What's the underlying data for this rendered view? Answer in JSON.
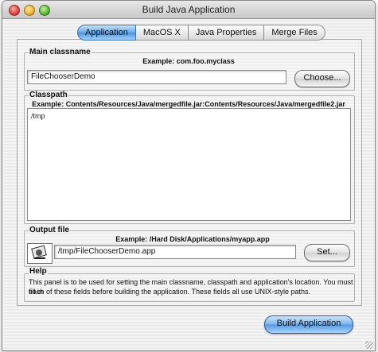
{
  "window": {
    "title": "Build Java Application"
  },
  "tabs": [
    {
      "label": "Application",
      "active": true
    },
    {
      "label": "MacOS X",
      "active": false
    },
    {
      "label": "Java Properties",
      "active": false
    },
    {
      "label": "Merge Files",
      "active": false
    }
  ],
  "main_classname": {
    "label": "Main classname",
    "example": "Example: com.foo.myclass",
    "value": "FileChooserDemo",
    "choose_button": "Choose..."
  },
  "classpath": {
    "label": "Classpath",
    "example": "Example: Contents/Resources/Java/mergedfile.jar:Contents/Resources/Java/mergedfile2.jar",
    "value": "/tmp"
  },
  "output_file": {
    "label": "Output file",
    "example": "Example: /Hard Disk/Applications/myapp.app",
    "value": "/tmp/FileChooserDemo.app",
    "set_button": "Set..."
  },
  "help": {
    "label": "Help",
    "line1": "This panel is to be used for setting the main classname, classpath and application's location. You must fill in",
    "line2": "each of these fields before building the application. These fields all use UNIX-style paths."
  },
  "footer": {
    "build_button": "Build Application"
  }
}
